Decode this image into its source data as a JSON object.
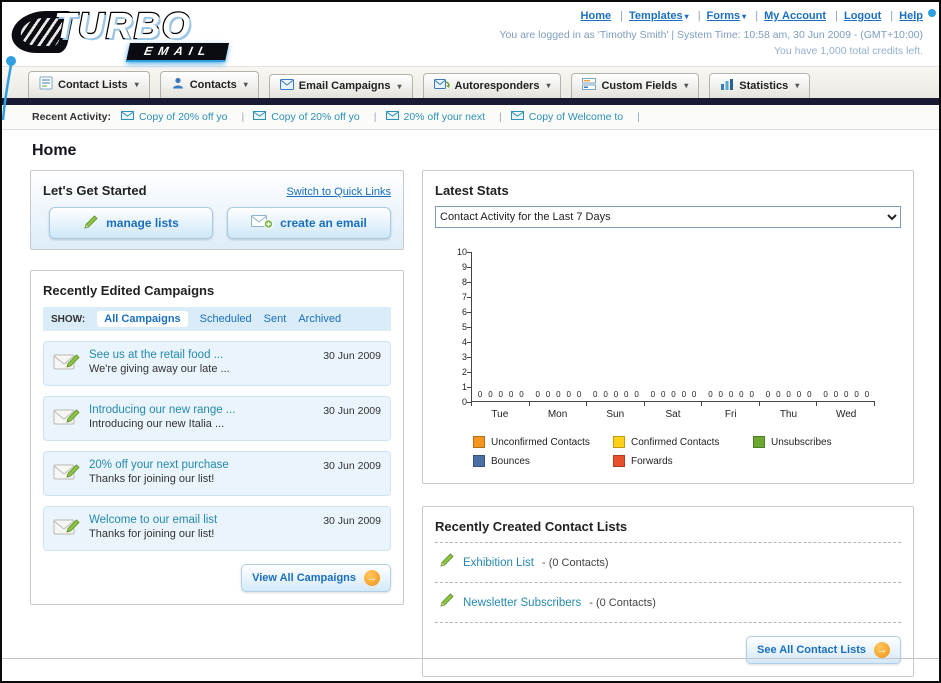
{
  "icons": {
    "caret_down": "▾",
    "arrow_right": "→"
  },
  "header": {
    "logo": {
      "line1": "TURBO",
      "line2": "EMAIL"
    },
    "nav_links": [
      "Home",
      "Templates",
      "Forms",
      "My Account",
      "Logout",
      "Help"
    ],
    "login_info": "You are logged in as 'Timothy Smith' | System Time: 10:58 am, 30 Jun 2009 - (GMT+10:00)",
    "credits_info": "You have 1,000 total credits left."
  },
  "tabs": [
    {
      "label": "Contact Lists"
    },
    {
      "label": "Contacts"
    },
    {
      "label": "Email Campaigns"
    },
    {
      "label": "Autoresponders"
    },
    {
      "label": "Custom Fields"
    },
    {
      "label": "Statistics"
    }
  ],
  "recent_activity": {
    "label": "Recent Activity:",
    "items": [
      "Copy of 20% off yo",
      "Copy of 20% off yo",
      "20% off your next",
      "Copy of Welcome to"
    ]
  },
  "page_title": "Home",
  "get_started": {
    "title": "Let's Get Started",
    "switch_link": "Switch to Quick Links",
    "buttons": [
      {
        "label": "manage lists"
      },
      {
        "label": "create an email"
      }
    ]
  },
  "campaigns": {
    "title": "Recently Edited Campaigns",
    "show_label": "SHOW:",
    "filters": [
      "All Campaigns",
      "Scheduled",
      "Sent",
      "Archived"
    ],
    "items": [
      {
        "title": "See us at the retail food ...",
        "subtitle": "We're giving away our late ...",
        "date": "30 Jun 2009"
      },
      {
        "title": "Introducing our new range ...",
        "subtitle": "Introducing our new Italia ...",
        "date": "30 Jun 2009"
      },
      {
        "title": "20% off your next purchase",
        "subtitle": "Thanks for joining our list!",
        "date": "30 Jun 2009"
      },
      {
        "title": "Welcome to our email list",
        "subtitle": "Thanks for joining our list!",
        "date": "30 Jun 2009"
      }
    ],
    "view_all_label": "View All Campaigns"
  },
  "stats": {
    "title": "Latest Stats",
    "dropdown_value": "Contact Activity for the Last 7 Days"
  },
  "chart_data": {
    "type": "bar",
    "title": "Contact Activity for the Last 7 Days",
    "categories": [
      "Tue",
      "Mon",
      "Sun",
      "Sat",
      "Fri",
      "Thu",
      "Wed"
    ],
    "series": [
      {
        "name": "Unconfirmed Contacts",
        "color": "#f5941f",
        "values": [
          0,
          0,
          0,
          0,
          0,
          0,
          0
        ]
      },
      {
        "name": "Confirmed Contacts",
        "color": "#fdd017",
        "values": [
          0,
          0,
          0,
          0,
          0,
          0,
          0
        ]
      },
      {
        "name": "Unsubscribes",
        "color": "#6aa832",
        "values": [
          0,
          0,
          0,
          0,
          0,
          0,
          0
        ]
      },
      {
        "name": "Bounces",
        "color": "#4a6fa5",
        "values": [
          0,
          0,
          0,
          0,
          0,
          0,
          0
        ]
      },
      {
        "name": "Forwards",
        "color": "#e8502a",
        "values": [
          0,
          0,
          0,
          0,
          0,
          0,
          0
        ]
      }
    ],
    "ylim": [
      0,
      10
    ],
    "ytick_step": 1,
    "grid": false,
    "legend_position": "bottom"
  },
  "contact_lists": {
    "title": "Recently Created Contact Lists",
    "items": [
      {
        "name": "Exhibition List",
        "detail": "- (0 Contacts)"
      },
      {
        "name": "Newsletter Subscribers",
        "detail": "- (0 Contacts)"
      }
    ],
    "see_all_label": "See All Contact Lists"
  }
}
